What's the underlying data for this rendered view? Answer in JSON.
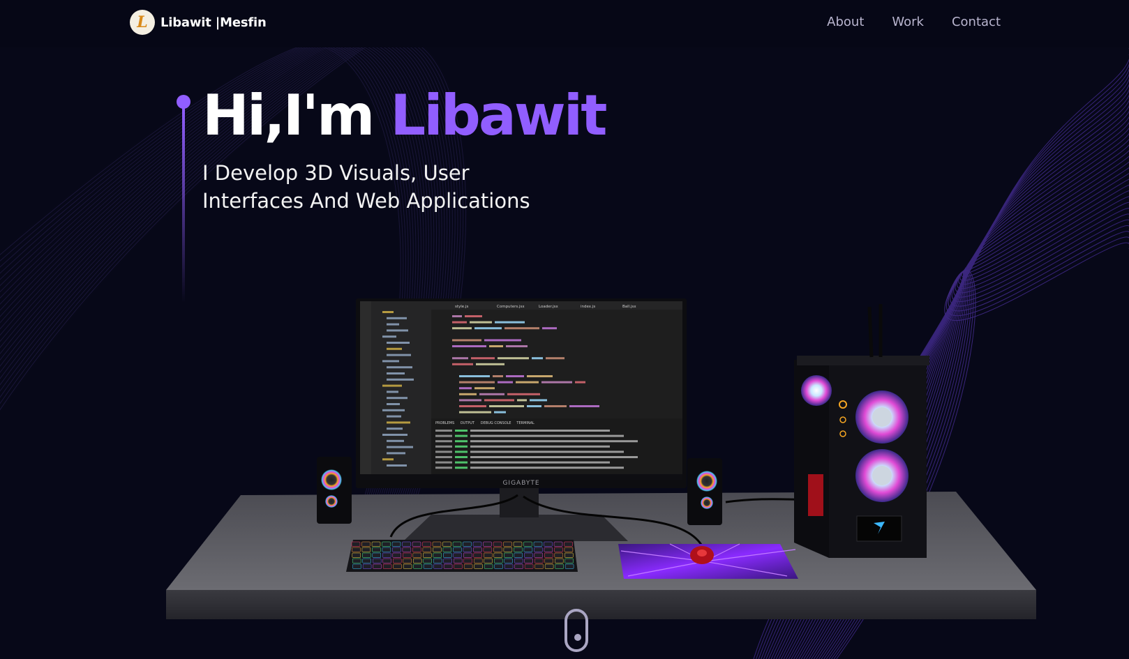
{
  "nav": {
    "logo_letter": "L",
    "logo_text": "Libawit |Mesfin",
    "links": [
      "About",
      "Work",
      "Contact"
    ]
  },
  "hero": {
    "greeting": "Hi,I'm ",
    "name": "Libawit",
    "subtitle_line1": "I Develop 3D Visuals, User",
    "subtitle_line2": "Interfaces And Web Applications"
  },
  "scene": {
    "monitor_brand": "GIGABYTE",
    "editor_tabs": [
      "style.js",
      "Computers.jsx",
      "Loader.jsx",
      "index.js",
      "Ball.jsx"
    ],
    "panel_tabs": [
      "PROBLEMS",
      "OUTPUT",
      "DEBUG CONSOLE",
      "TERMINAL"
    ]
  },
  "colors": {
    "accent": "#915eff",
    "background": "#070818",
    "nav_text": "#b9b5cf",
    "wave": "#6a3cd8"
  },
  "icons": {
    "scroll": "mouse-scroll-icon",
    "logo": "logo-badge-icon"
  }
}
